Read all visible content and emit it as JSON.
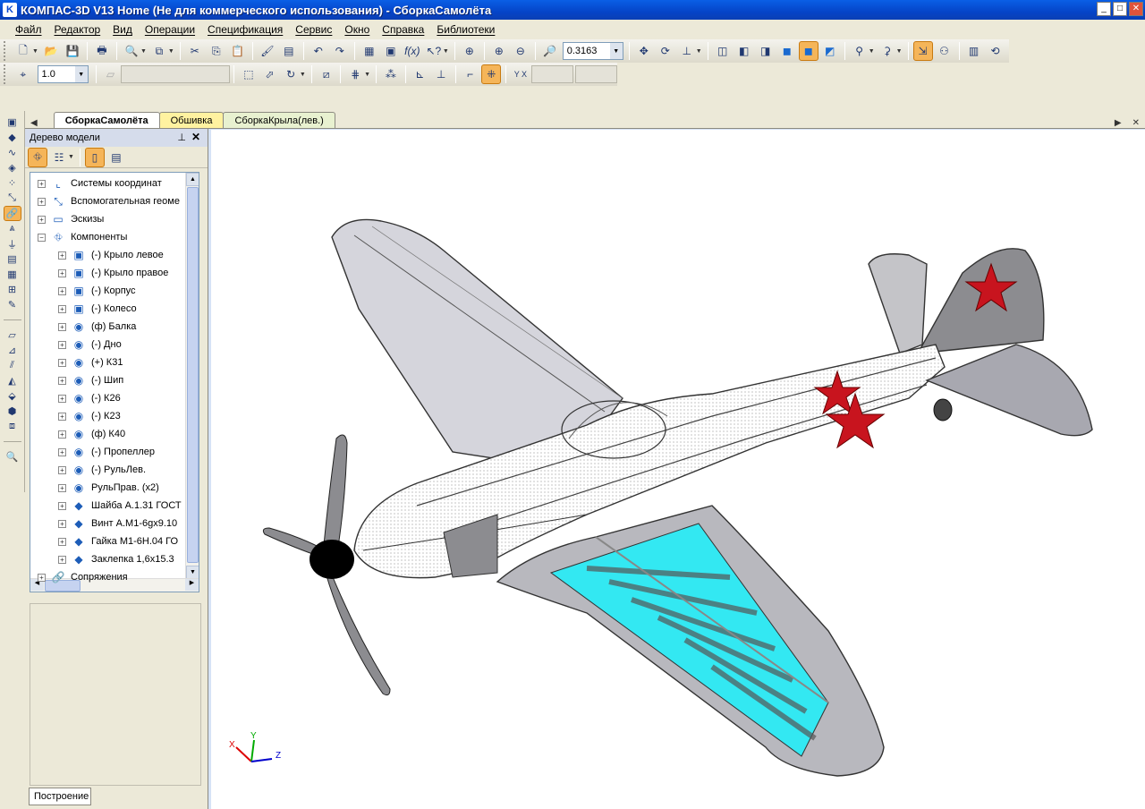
{
  "window": {
    "title": "КОМПАС-3D V13 Home (Не для коммерческого использования) - СборкаСамолёта"
  },
  "menu": [
    "Файл",
    "Редактор",
    "Вид",
    "Операции",
    "Спецификация",
    "Сервис",
    "Окно",
    "Справка",
    "Библиотеки"
  ],
  "toolbar": {
    "zoom_value": "0.3163",
    "step_value": "1.0"
  },
  "tabs": [
    {
      "label": "СборкаСамолёта",
      "state": "active"
    },
    {
      "label": "Обшивка",
      "state": "yellow"
    },
    {
      "label": "СборкаКрыла(лев.)",
      "state": "green"
    }
  ],
  "tree": {
    "title": "Дерево модели",
    "items": [
      {
        "label": "Системы координат",
        "icon": "axes-icon"
      },
      {
        "label": "Вспомогательная геоме",
        "icon": "aux-geometry-icon"
      },
      {
        "label": "Эскизы",
        "icon": "sketch-icon"
      },
      {
        "label": "Компоненты",
        "icon": "components-icon"
      },
      {
        "label": "(-) Крыло левое",
        "icon": "assembly-icon"
      },
      {
        "label": "(-) Крыло правое",
        "icon": "assembly-icon"
      },
      {
        "label": "(-) Корпус",
        "icon": "assembly-icon"
      },
      {
        "label": "(-) Колесо",
        "icon": "assembly-icon"
      },
      {
        "label": "(ф) Балка",
        "icon": "part-icon"
      },
      {
        "label": "(-) Дно",
        "icon": "part-icon"
      },
      {
        "label": "(+) К31",
        "icon": "part-icon"
      },
      {
        "label": "(-) Шип",
        "icon": "part-icon"
      },
      {
        "label": "(-) К26",
        "icon": "part-icon"
      },
      {
        "label": "(-) К23",
        "icon": "part-icon"
      },
      {
        "label": "(ф) К40",
        "icon": "part-icon"
      },
      {
        "label": "(-) Пропеллер",
        "icon": "part-icon"
      },
      {
        "label": "(-) РульЛев.",
        "icon": "part-icon"
      },
      {
        "label": "РульПрав. (x2)",
        "icon": "part-icon"
      },
      {
        "label": "Шайба А.1.31 ГОСТ",
        "icon": "standard-part-icon"
      },
      {
        "label": "Винт А.М1-6gx9.10",
        "icon": "standard-part-icon"
      },
      {
        "label": "Гайка М1-6Н.04 ГО",
        "icon": "standard-part-icon"
      },
      {
        "label": "Заклепка 1,6х15.3",
        "icon": "standard-part-icon"
      },
      {
        "label": "Сопряжения",
        "icon": "mates-icon"
      }
    ],
    "bottom_tab": "Построение"
  },
  "viewport": {
    "axes": {
      "x": "X",
      "y": "Y",
      "z": "Z"
    }
  },
  "colors": {
    "accent": "#F5B559",
    "titlebar": "#0A5FE6",
    "star": "#C8141E",
    "wing_inner": "#33E8F2"
  }
}
